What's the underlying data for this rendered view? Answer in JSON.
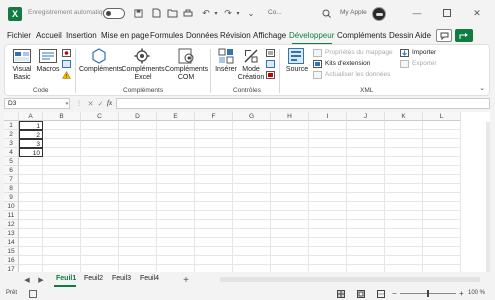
{
  "titlebar": {
    "autosave_label": "Enregistrement automatique",
    "doc_title": "Co...",
    "user_name": "My Apple"
  },
  "tabs": [
    "Fichier",
    "Accueil",
    "Insertion",
    "Mise en page",
    "Formules",
    "Données",
    "Révision",
    "Affichage",
    "Développeur",
    "Compléments",
    "Dessin",
    "Aide"
  ],
  "active_tab": "Développeur",
  "ribbon": {
    "code": {
      "label": "Code",
      "visual_basic": "Visual Basic",
      "macros": "Macros"
    },
    "complements": {
      "label": "Compléments",
      "complements": "Compléments",
      "complements_excel": "Compléments Excel",
      "complements_com": "Compléments COM"
    },
    "controles": {
      "label": "Contrôles",
      "inserer": "Insérer",
      "mode_creation": "Mode Création"
    },
    "xml": {
      "label": "XML",
      "source": "Source",
      "proprietes_mappage": "Propriétés du mappage",
      "kits_extension": "Kits d'extension",
      "actualiser": "Actualiser les données",
      "importer": "Importer",
      "exporter": "Exporter"
    }
  },
  "formula": {
    "namebox": "D3",
    "fx": "fx"
  },
  "columns": [
    "A",
    "B",
    "C",
    "D",
    "E",
    "F",
    "G",
    "H",
    "I",
    "J",
    "K",
    "L"
  ],
  "rows": [
    "1",
    "2",
    "3",
    "4",
    "5",
    "6",
    "7",
    "8",
    "9",
    "10",
    "11",
    "12",
    "13",
    "14",
    "15",
    "16",
    "17"
  ],
  "cells": {
    "A1": "1",
    "A2": "2",
    "A3": "3",
    "A4": "10"
  },
  "sheets": [
    "Feuil1",
    "Feuil2",
    "Feuil3",
    "Feuil4"
  ],
  "active_sheet": "Feuil1",
  "status": {
    "ready": "Prêt",
    "zoom": "100 %"
  },
  "colors": {
    "accent": "#107c41"
  }
}
